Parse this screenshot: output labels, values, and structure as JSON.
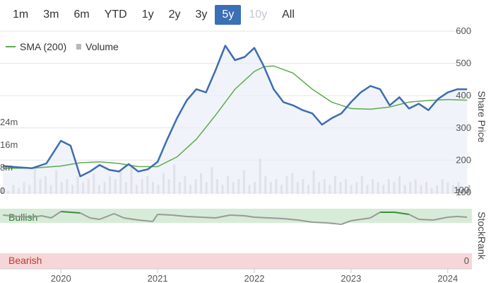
{
  "range_selector": [
    {
      "label": "1m",
      "state": "normal"
    },
    {
      "label": "3m",
      "state": "normal"
    },
    {
      "label": "6m",
      "state": "normal"
    },
    {
      "label": "YTD",
      "state": "normal"
    },
    {
      "label": "1y",
      "state": "normal"
    },
    {
      "label": "2y",
      "state": "normal"
    },
    {
      "label": "3y",
      "state": "normal"
    },
    {
      "label": "5y",
      "state": "active"
    },
    {
      "label": "10y",
      "state": "disabled"
    },
    {
      "label": "All",
      "state": "normal"
    }
  ],
  "legend": {
    "sma_label": "SMA (200)",
    "volume_label": "Volume"
  },
  "colors": {
    "price": "#3e6db0",
    "sma": "#5cab4f",
    "volume": "#c6c6c6",
    "active_button": "#3b6fb6",
    "bullish_band": "#d6ecd8",
    "bearish_band": "#f6d6d8",
    "stockrank_line": "#999999",
    "stockrank_bullish": "#3a8f3a"
  },
  "chart_data": [
    {
      "type": "line",
      "x_ticks": [
        "2020",
        "2021",
        "2022",
        "2023",
        "2024"
      ],
      "xlim": [
        "2019-05",
        "2024-03"
      ],
      "y_ticks": [
        100,
        200,
        300,
        400,
        500,
        600
      ],
      "ylim": [
        100,
        600
      ],
      "ylabel": "Share Price",
      "volume_ticks": [
        "0",
        "8m",
        "16m",
        "24m"
      ],
      "volume_lim": [
        0,
        24
      ],
      "series": [
        {
          "name": "",
          "x": [
            2019.4,
            2019.55,
            2019.7,
            2019.85,
            2020.0,
            2020.1,
            2020.2,
            2020.3,
            2020.4,
            2020.5,
            2020.6,
            2020.7,
            2020.8,
            2020.9,
            2021.0,
            2021.1,
            2021.2,
            2021.3,
            2021.4,
            2021.5,
            2021.6,
            2021.7,
            2021.8,
            2021.9,
            2022.0,
            2022.1,
            2022.2,
            2022.3,
            2022.4,
            2022.5,
            2022.6,
            2022.7,
            2022.8,
            2022.9,
            2023.0,
            2023.1,
            2023.2,
            2023.3,
            2023.4,
            2023.5,
            2023.6,
            2023.7,
            2023.8,
            2023.9,
            2024.0,
            2024.1,
            2024.2
          ],
          "values": [
            182,
            178,
            175,
            190,
            260,
            245,
            150,
            165,
            185,
            170,
            165,
            188,
            165,
            172,
            195,
            265,
            330,
            385,
            420,
            410,
            480,
            555,
            510,
            520,
            548,
            490,
            420,
            380,
            370,
            355,
            345,
            310,
            330,
            345,
            380,
            410,
            430,
            420,
            370,
            395,
            360,
            375,
            355,
            390,
            410,
            420,
            420
          ]
        },
        {
          "name": "SMA (200)",
          "x": [
            2019.4,
            2019.7,
            2020.0,
            2020.2,
            2020.4,
            2020.6,
            2020.8,
            2021.0,
            2021.2,
            2021.4,
            2021.6,
            2021.8,
            2022.0,
            2022.1,
            2022.2,
            2022.4,
            2022.6,
            2022.8,
            2023.0,
            2023.2,
            2023.4,
            2023.6,
            2023.8,
            2024.0,
            2024.2
          ],
          "values": [
            175,
            175,
            182,
            192,
            195,
            190,
            180,
            180,
            210,
            265,
            340,
            420,
            475,
            490,
            492,
            470,
            420,
            380,
            360,
            358,
            365,
            380,
            385,
            388,
            386
          ]
        }
      ],
      "volume": [
        2,
        1,
        3,
        2,
        4,
        3,
        9,
        5,
        6,
        3,
        8,
        4,
        5,
        3,
        6,
        4,
        5,
        7,
        3,
        4,
        6,
        5,
        8,
        4,
        9,
        3,
        5,
        6,
        4,
        3,
        7,
        5,
        10,
        4,
        6,
        3,
        5,
        7,
        4,
        9,
        5,
        3,
        6,
        4,
        5,
        8,
        3,
        4,
        12,
        6,
        4,
        5,
        3,
        6,
        7,
        4,
        5,
        3,
        8,
        4,
        5,
        3,
        6,
        4,
        5,
        3,
        4,
        6,
        3,
        5,
        4,
        3,
        5,
        4,
        6,
        3,
        4,
        5,
        3,
        4,
        2,
        3,
        5,
        4,
        3,
        4,
        2,
        3
      ]
    },
    {
      "type": "line",
      "title": "StockRank",
      "ylim": [
        0,
        100
      ],
      "y_ticks": [
        0,
        100
      ],
      "bands": [
        {
          "label": "Bullish",
          "range": [
            80,
            100
          ]
        },
        {
          "label": "Bearish",
          "range": [
            0,
            20
          ]
        }
      ],
      "series": [
        {
          "name": "",
          "x": [
            2019.4,
            2019.55,
            2019.7,
            2019.8,
            2019.9,
            2020.0,
            2020.1,
            2020.2,
            2020.3,
            2020.4,
            2020.55,
            2020.65,
            2020.8,
            2020.95,
            2021.0,
            2021.15,
            2021.3,
            2021.45,
            2021.6,
            2021.75,
            2021.9,
            2022.0,
            2022.15,
            2022.3,
            2022.45,
            2022.6,
            2022.75,
            2022.9,
            2023.0,
            2023.1,
            2023.2,
            2023.3,
            2023.45,
            2023.6,
            2023.7,
            2023.85,
            2024.0,
            2024.1,
            2024.2
          ],
          "values": [
            78,
            74,
            72,
            76,
            70,
            88,
            86,
            84,
            70,
            66,
            82,
            70,
            64,
            60,
            80,
            78,
            74,
            72,
            70,
            78,
            76,
            72,
            70,
            68,
            64,
            58,
            56,
            52,
            62,
            66,
            70,
            86,
            86,
            80,
            66,
            64,
            72,
            74,
            72
          ]
        }
      ]
    }
  ],
  "labels": {
    "bullish": "Bullish",
    "bearish": "Bearish",
    "stockrank_axis": "StockRank",
    "price_axis": "Share Price"
  }
}
